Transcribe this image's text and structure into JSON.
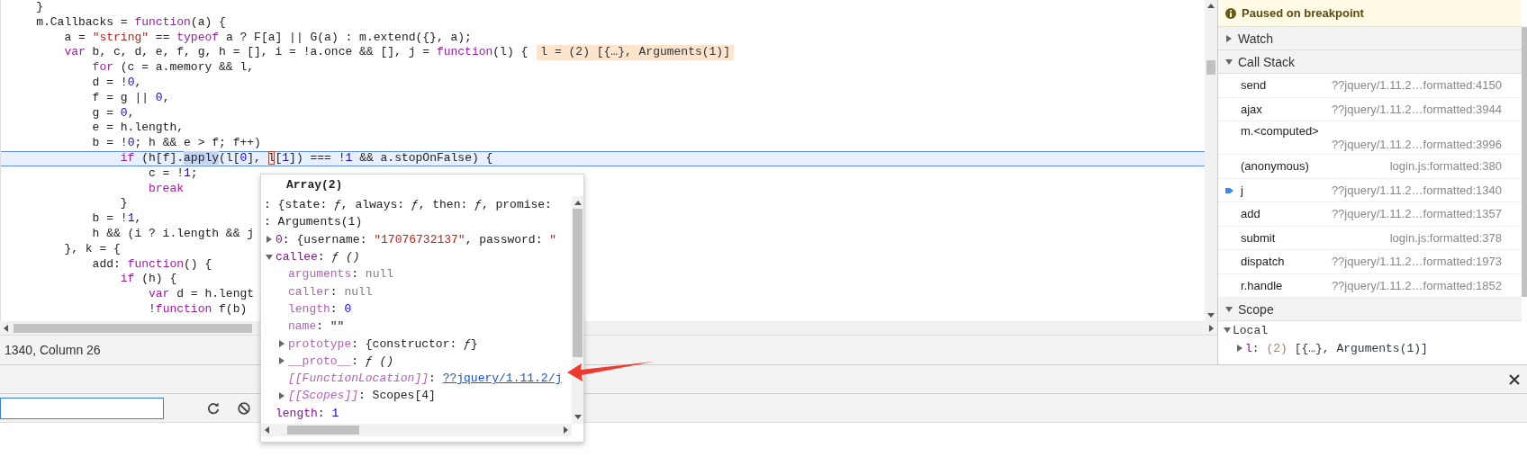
{
  "editor": {
    "lines": [
      {
        "current": false,
        "segments": [
          {
            "kind": "p",
            "text": "    }"
          }
        ]
      },
      {
        "current": false,
        "segments": [
          {
            "kind": "p",
            "text": "    m.Callbacks = "
          },
          {
            "kind": "kw",
            "text": "function"
          },
          {
            "kind": "p",
            "text": "(a) {"
          }
        ]
      },
      {
        "current": false,
        "segments": [
          {
            "kind": "p",
            "text": "        a = "
          },
          {
            "kind": "str",
            "text": "\"string\""
          },
          {
            "kind": "p",
            "text": " == "
          },
          {
            "kind": "kw",
            "text": "typeof"
          },
          {
            "kind": "p",
            "text": " a ? F[a] || G(a) : m.extend({}, a);"
          }
        ]
      },
      {
        "current": false,
        "segments": [
          {
            "kind": "kw",
            "text": "        var"
          },
          {
            "kind": "p",
            "text": " b, c, d, e, f, g, h = [], i = !a.once && [], j = "
          },
          {
            "kind": "kw",
            "text": "function"
          },
          {
            "kind": "p",
            "text": "(l) {"
          }
        ],
        "inline_value": "l = (2) [{…}, Arguments(1)]"
      },
      {
        "current": false,
        "segments": [
          {
            "kind": "kw",
            "text": "            for"
          },
          {
            "kind": "p",
            "text": " (c = a.memory && l,"
          }
        ]
      },
      {
        "current": false,
        "segments": [
          {
            "kind": "p",
            "text": "            d = !"
          },
          {
            "kind": "num",
            "text": "0"
          },
          {
            "kind": "p",
            "text": ","
          }
        ]
      },
      {
        "current": false,
        "segments": [
          {
            "kind": "p",
            "text": "            f = g || "
          },
          {
            "kind": "num",
            "text": "0"
          },
          {
            "kind": "p",
            "text": ","
          }
        ]
      },
      {
        "current": false,
        "segments": [
          {
            "kind": "p",
            "text": "            g = "
          },
          {
            "kind": "num",
            "text": "0"
          },
          {
            "kind": "p",
            "text": ","
          }
        ]
      },
      {
        "current": false,
        "segments": [
          {
            "kind": "p",
            "text": "            e = h.length,"
          }
        ]
      },
      {
        "current": false,
        "segments": [
          {
            "kind": "p",
            "text": "            b = !"
          },
          {
            "kind": "num",
            "text": "0"
          },
          {
            "kind": "p",
            "text": "; h && e > f; f++)"
          }
        ]
      },
      {
        "current": true,
        "segments": [
          {
            "kind": "kw",
            "text": "                if"
          },
          {
            "kind": "p",
            "text": " (h[f]."
          },
          {
            "kind": "sel",
            "text": "apply"
          },
          {
            "kind": "p",
            "text": "(l["
          },
          {
            "kind": "num",
            "text": "0"
          },
          {
            "kind": "p",
            "text": "], "
          },
          {
            "kind": "hover",
            "text": "l"
          },
          {
            "kind": "p",
            "text": "["
          },
          {
            "kind": "num",
            "text": "1"
          },
          {
            "kind": "p",
            "text": "]) === !"
          },
          {
            "kind": "num",
            "text": "1"
          },
          {
            "kind": "p",
            "text": " && a.stopOnFalse) {"
          }
        ]
      },
      {
        "current": false,
        "segments": [
          {
            "kind": "p",
            "text": "                    c = !"
          },
          {
            "kind": "num",
            "text": "1"
          },
          {
            "kind": "p",
            "text": ";"
          }
        ]
      },
      {
        "current": false,
        "segments": [
          {
            "kind": "kw",
            "text": "                    break"
          }
        ]
      },
      {
        "current": false,
        "segments": [
          {
            "kind": "p",
            "text": "                }"
          }
        ]
      },
      {
        "current": false,
        "segments": [
          {
            "kind": "p",
            "text": "            b = !"
          },
          {
            "kind": "num",
            "text": "1"
          },
          {
            "kind": "p",
            "text": ","
          }
        ]
      },
      {
        "current": false,
        "segments": [
          {
            "kind": "p",
            "text": "            h && (i ? i.length && j"
          }
        ]
      },
      {
        "current": false,
        "segments": [
          {
            "kind": "p",
            "text": "        }, k = {"
          }
        ]
      },
      {
        "current": false,
        "segments": [
          {
            "kind": "p",
            "text": "            add: "
          },
          {
            "kind": "kw",
            "text": "function"
          },
          {
            "kind": "p",
            "text": "() {"
          }
        ]
      },
      {
        "current": false,
        "segments": [
          {
            "kind": "kw",
            "text": "                if"
          },
          {
            "kind": "p",
            "text": " (h) {"
          }
        ]
      },
      {
        "current": false,
        "segments": [
          {
            "kind": "kw",
            "text": "                    var"
          },
          {
            "kind": "p",
            "text": " d = h.lengt"
          }
        ]
      },
      {
        "current": false,
        "segments": [
          {
            "kind": "p",
            "text": "                    !"
          },
          {
            "kind": "kw",
            "text": "function"
          },
          {
            "kind": "p",
            "text": " f(b)"
          }
        ]
      }
    ],
    "status": "1340, Column 26"
  },
  "popover": {
    "title": "Array(2)",
    "rows": [
      {
        "segments": [
          {
            "kind": "p",
            "text": ": {state: "
          },
          {
            "kind": "fn",
            "text": "ƒ"
          },
          {
            "kind": "p",
            "text": ", always: "
          },
          {
            "kind": "fn",
            "text": "ƒ"
          },
          {
            "kind": "p",
            "text": ", then: "
          },
          {
            "kind": "fn",
            "text": "ƒ"
          },
          {
            "kind": "p",
            "text": ", promise:"
          }
        ]
      },
      {
        "segments": [
          {
            "kind": "p",
            "text": ": Arguments(1)"
          }
        ],
        "children": [
          {
            "expanded": false,
            "segments": [
              {
                "kind": "key",
                "text": "0"
              },
              {
                "kind": "p",
                "text": ": {username: "
              },
              {
                "kind": "str",
                "text": "\"17076732137\""
              },
              {
                "kind": "p",
                "text": ", password: "
              },
              {
                "kind": "str",
                "text": "\""
              }
            ]
          },
          {
            "expanded": true,
            "segments": [
              {
                "kind": "key",
                "text": "callee"
              },
              {
                "kind": "p",
                "text": ": "
              },
              {
                "kind": "fn",
                "text": "ƒ ()"
              }
            ],
            "children": [
              {
                "segments": [
                  {
                    "kind": "dim",
                    "text": "arguments"
                  },
                  {
                    "kind": "p",
                    "text": ": "
                  },
                  {
                    "kind": "null",
                    "text": "null"
                  }
                ]
              },
              {
                "segments": [
                  {
                    "kind": "dim",
                    "text": "caller"
                  },
                  {
                    "kind": "p",
                    "text": ": "
                  },
                  {
                    "kind": "null",
                    "text": "null"
                  }
                ]
              },
              {
                "segments": [
                  {
                    "kind": "dim",
                    "text": "length"
                  },
                  {
                    "kind": "p",
                    "text": ": "
                  },
                  {
                    "kind": "num",
                    "text": "0"
                  }
                ]
              },
              {
                "segments": [
                  {
                    "kind": "dim",
                    "text": "name"
                  },
                  {
                    "kind": "p",
                    "text": ": \"\""
                  }
                ]
              },
              {
                "expanded": false,
                "segments": [
                  {
                    "kind": "dim",
                    "text": "prototype"
                  },
                  {
                    "kind": "p",
                    "text": ": {constructor: "
                  },
                  {
                    "kind": "fn",
                    "text": "ƒ"
                  },
                  {
                    "kind": "p",
                    "text": "}"
                  }
                ]
              },
              {
                "expanded": false,
                "segments": [
                  {
                    "kind": "dim",
                    "text": "__proto__"
                  },
                  {
                    "kind": "p",
                    "text": ": "
                  },
                  {
                    "kind": "fn",
                    "text": "ƒ ()"
                  }
                ]
              },
              {
                "segments": [
                  {
                    "kind": "internal",
                    "text": "[[FunctionLocation]]"
                  },
                  {
                    "kind": "p",
                    "text": ": "
                  },
                  {
                    "kind": "link",
                    "text": "??jquery/1.11.2/j"
                  }
                ]
              },
              {
                "expanded": false,
                "segments": [
                  {
                    "kind": "internal",
                    "text": "[[Scopes]]"
                  },
                  {
                    "kind": "p",
                    "text": ": Scopes[4]"
                  }
                ]
              }
            ]
          },
          {
            "segments": [
              {
                "kind": "key",
                "text": "length"
              },
              {
                "kind": "p",
                "text": ": "
              },
              {
                "kind": "num",
                "text": "1"
              }
            ]
          }
        ]
      }
    ]
  },
  "sidebar": {
    "banner": "Paused on breakpoint",
    "watch": {
      "title": "Watch",
      "expanded": false
    },
    "call_stack": {
      "title": "Call Stack",
      "expanded": true,
      "frames": [
        {
          "name": "send",
          "location": "??jquery/1.11.2…formatted:4150",
          "selected": false
        },
        {
          "name": "ajax",
          "location": "??jquery/1.11.2…formatted:3944",
          "selected": false
        },
        {
          "name": "m.<computed>",
          "location": "??jquery/1.11.2…formatted:3996",
          "selected": false
        },
        {
          "name": "(anonymous)",
          "location": "login.js:formatted:380",
          "selected": false
        },
        {
          "name": "j",
          "location": "??jquery/1.11.2…formatted:1340",
          "selected": true
        },
        {
          "name": "add",
          "location": "??jquery/1.11.2…formatted:1357",
          "selected": false
        },
        {
          "name": "submit",
          "location": "login.js:formatted:378",
          "selected": false
        },
        {
          "name": "dispatch",
          "location": "??jquery/1.11.2…formatted:1973",
          "selected": false
        },
        {
          "name": "r.handle",
          "location": "??jquery/1.11.2…formatted:1852",
          "selected": false
        }
      ]
    },
    "scope": {
      "title": "Scope",
      "expanded": true,
      "groups": [
        {
          "title": "Local",
          "expanded": true,
          "items": [
            {
              "expanded": false,
              "segments": [
                {
                  "kind": "key",
                  "text": "l"
                },
                {
                  "kind": "p",
                  "text": ": "
                },
                {
                  "kind": "dim2",
                  "text": "(2)"
                },
                {
                  "kind": "p",
                  "text": " [{…}, Arguments(1)]"
                }
              ]
            }
          ]
        }
      ]
    }
  }
}
